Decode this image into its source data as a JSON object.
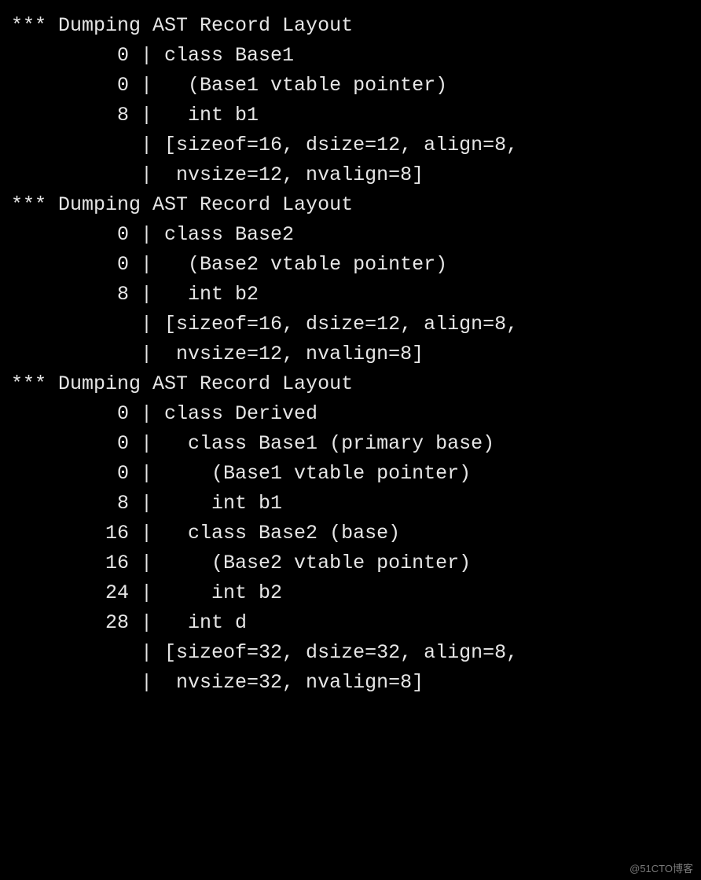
{
  "header_text": "*** Dumping AST Record Layout",
  "records": [
    {
      "rows": [
        {
          "offset": "0",
          "text": "class Base1",
          "indent": 0
        },
        {
          "offset": "0",
          "text": "(Base1 vtable pointer)",
          "indent": 1
        },
        {
          "offset": "8",
          "text": "int b1",
          "indent": 1
        }
      ],
      "summary": [
        "[sizeof=16, dsize=12, align=8,",
        " nvsize=12, nvalign=8]"
      ]
    },
    {
      "rows": [
        {
          "offset": "0",
          "text": "class Base2",
          "indent": 0
        },
        {
          "offset": "0",
          "text": "(Base2 vtable pointer)",
          "indent": 1
        },
        {
          "offset": "8",
          "text": "int b2",
          "indent": 1
        }
      ],
      "summary": [
        "[sizeof=16, dsize=12, align=8,",
        " nvsize=12, nvalign=8]"
      ]
    },
    {
      "rows": [
        {
          "offset": "0",
          "text": "class Derived",
          "indent": 0
        },
        {
          "offset": "0",
          "text": "class Base1 (primary base)",
          "indent": 1
        },
        {
          "offset": "0",
          "text": "(Base1 vtable pointer)",
          "indent": 2
        },
        {
          "offset": "8",
          "text": "int b1",
          "indent": 2
        },
        {
          "offset": "16",
          "text": "class Base2 (base)",
          "indent": 1
        },
        {
          "offset": "16",
          "text": "(Base2 vtable pointer)",
          "indent": 2
        },
        {
          "offset": "24",
          "text": "int b2",
          "indent": 2
        },
        {
          "offset": "28",
          "text": "int d",
          "indent": 1
        }
      ],
      "summary": [
        "[sizeof=32, dsize=32, align=8,",
        " nvsize=32, nvalign=8]"
      ]
    }
  ],
  "watermark": "@51CTO博客"
}
